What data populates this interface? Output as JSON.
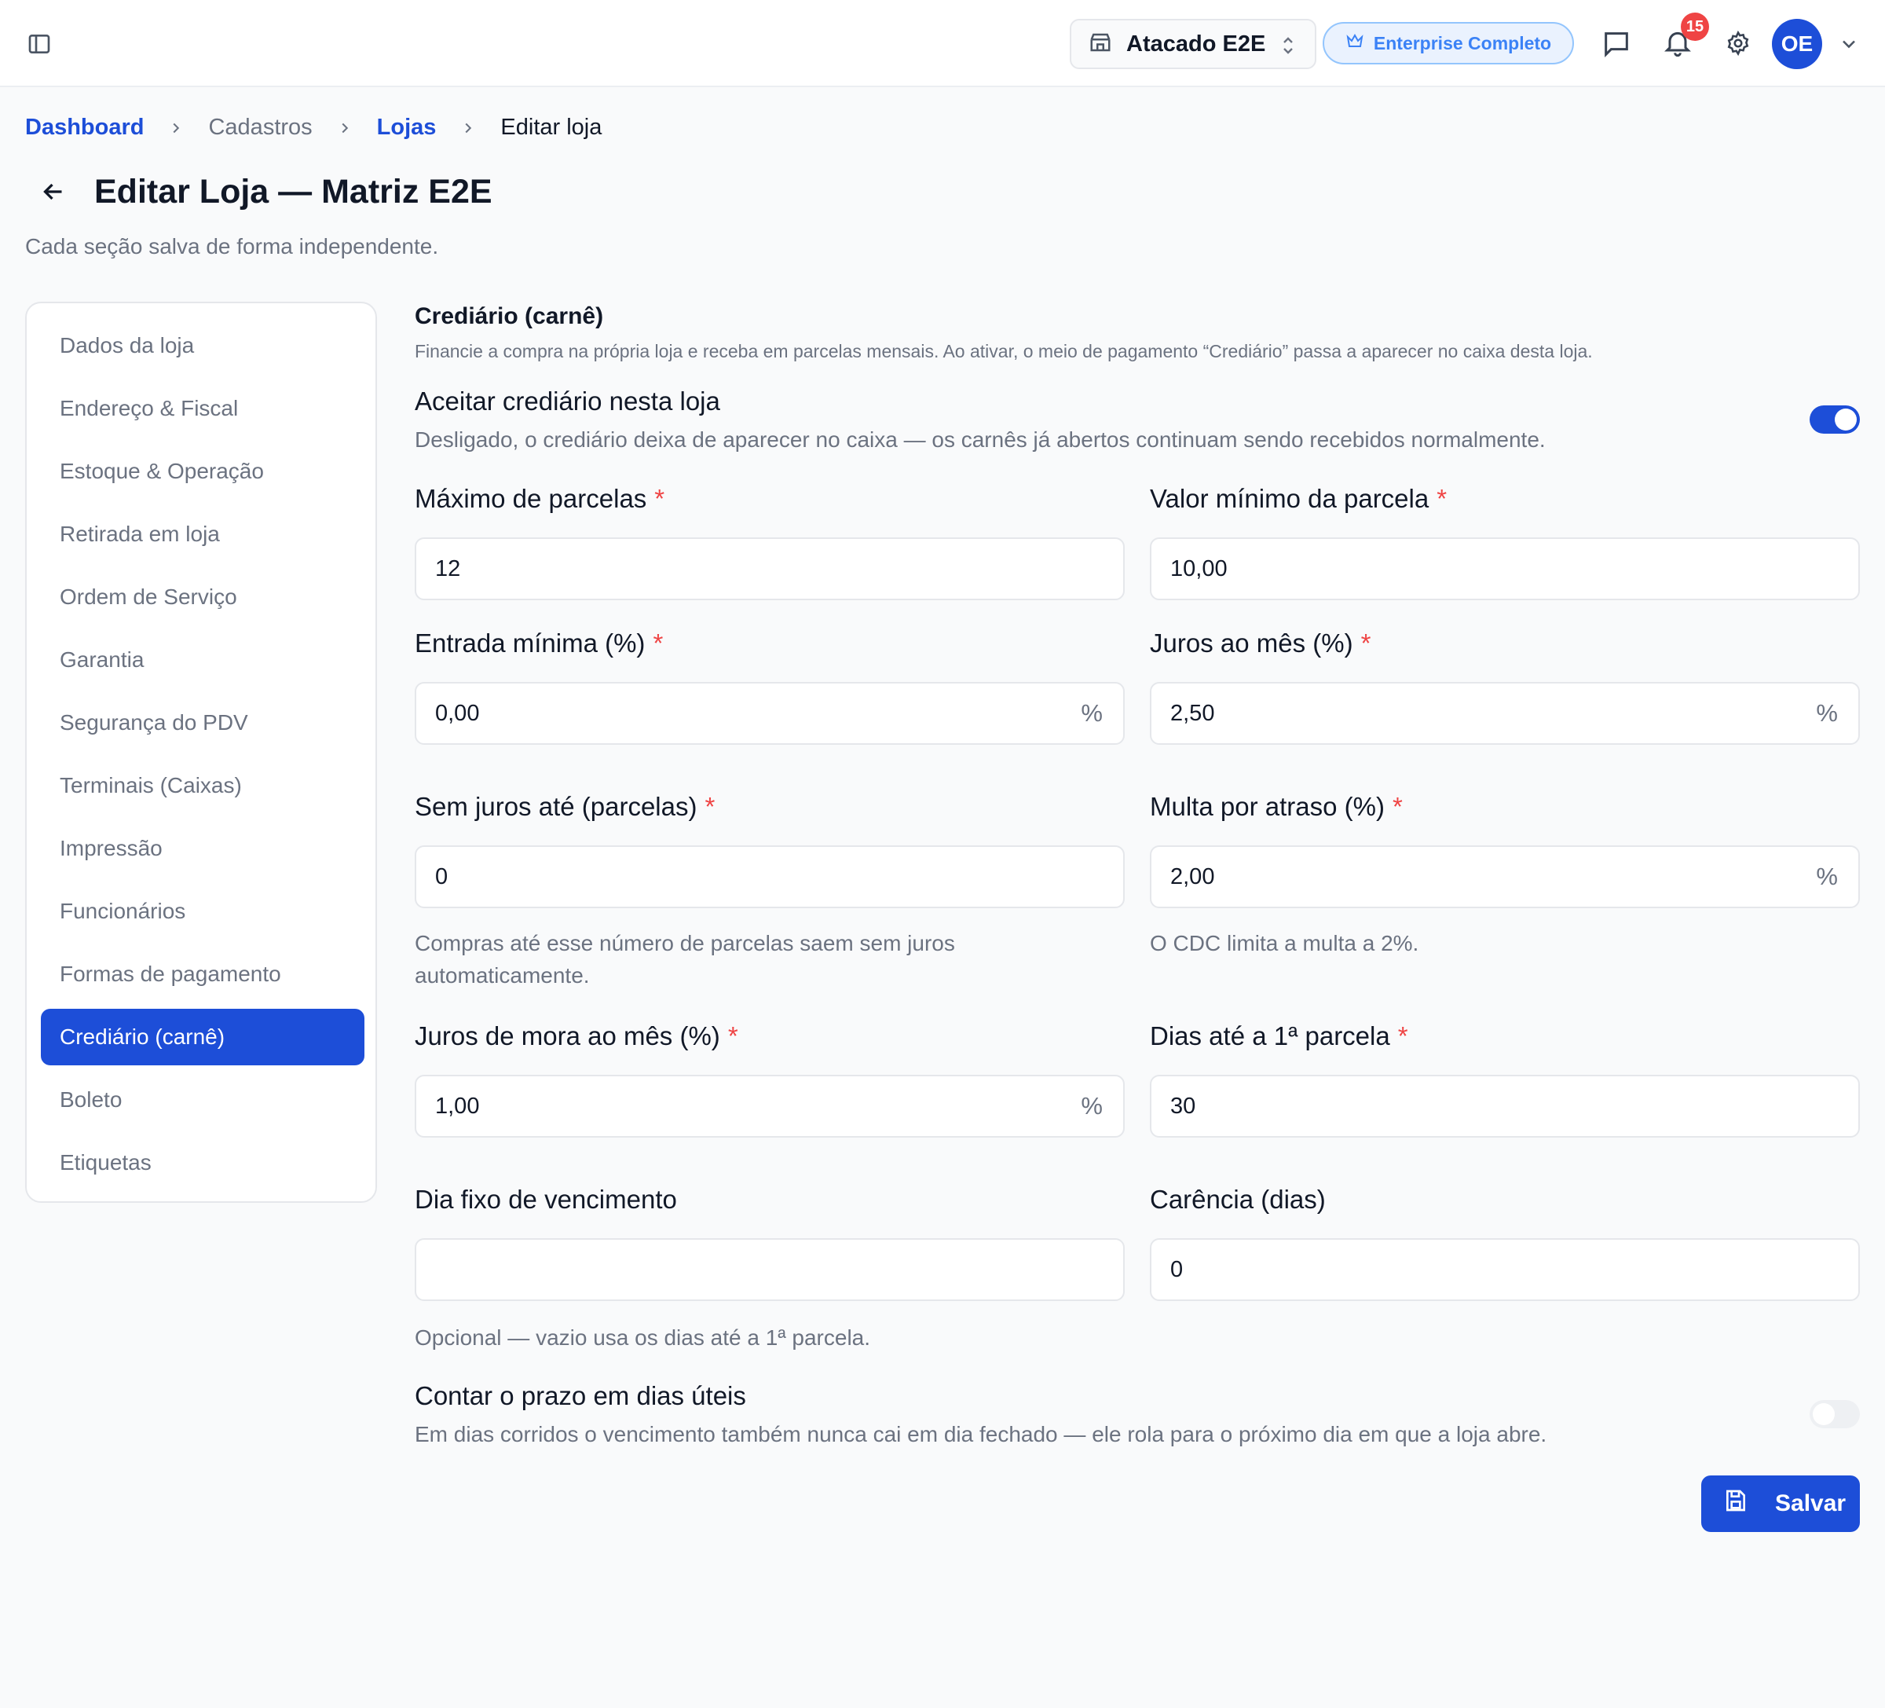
{
  "topbar": {
    "store_name": "Atacado E2E",
    "plan_label": "Enterprise Completo",
    "notification_count": "15",
    "avatar_initials": "OE"
  },
  "breadcrumb": {
    "items": [
      "Dashboard",
      "Cadastros",
      "Lojas",
      "Editar loja"
    ]
  },
  "page": {
    "title": "Editar Loja — Matriz E2E",
    "subtitle": "Cada seção salva de forma independente."
  },
  "nav": {
    "items": [
      "Dados da loja",
      "Endereço & Fiscal",
      "Estoque & Operação",
      "Retirada em loja",
      "Ordem de Serviço",
      "Garantia",
      "Segurança do PDV",
      "Terminais (Caixas)",
      "Impressão",
      "Funcionários",
      "Formas de pagamento",
      "Crediário (carnê)",
      "Boleto",
      "Etiquetas"
    ],
    "active": "Crediário (carnê)"
  },
  "section": {
    "title": "Crediário (carnê)",
    "description": "Financie a compra na própria loja e receba em parcelas mensais. Ao ativar, o meio de pagamento “Crediário” passa a aparecer no caixa desta loja.",
    "accept": {
      "title": "Aceitar crediário nesta loja",
      "description": "Desligado, o crediário deixa de aparecer no caixa — os carnês já abertos continuam sendo recebidos normalmente.",
      "enabled": true
    },
    "business_days": {
      "title": "Contar o prazo em dias úteis",
      "description": "Em dias corridos o vencimento também nunca cai em dia fechado — ele rola para o próximo dia em que a loja abre.",
      "enabled": false
    }
  },
  "fields": {
    "max_parcelas": {
      "label": "Máximo de parcelas",
      "required": "*",
      "value": "12"
    },
    "valor_minimo": {
      "label": "Valor mínimo da parcela",
      "required": "*",
      "value": "10,00"
    },
    "entrada_minima": {
      "label": "Entrada mínima (%)",
      "required": "*",
      "value": "0,00",
      "suffix": "%"
    },
    "juros_mes": {
      "label": "Juros ao mês (%)",
      "required": "*",
      "value": "2,50",
      "suffix": "%"
    },
    "sem_juros": {
      "label": "Sem juros até (parcelas)",
      "required": "*",
      "value": "0",
      "help": "Compras até esse número de parcelas saem sem juros automaticamente."
    },
    "multa_atraso": {
      "label": "Multa por atraso (%)",
      "required": "*",
      "value": "2,00",
      "suffix": "%",
      "help": "O CDC limita a multa a 2%."
    },
    "juros_mora": {
      "label": "Juros de mora ao mês (%)",
      "required": "*",
      "value": "1,00",
      "suffix": "%"
    },
    "dias_primeira": {
      "label": "Dias até a 1ª parcela",
      "required": "*",
      "value": "30"
    },
    "dia_fixo": {
      "label": "Dia fixo de vencimento",
      "value": "",
      "help": "Opcional — vazio usa os dias até a 1ª parcela."
    },
    "carencia": {
      "label": "Carência (dias)",
      "value": "0"
    }
  },
  "actions": {
    "save_label": "Salvar"
  },
  "colors": {
    "primary": "#1d4ed8",
    "required": "#ef4444",
    "badge": "#ef4444",
    "plan_text": "#3b82f6"
  }
}
